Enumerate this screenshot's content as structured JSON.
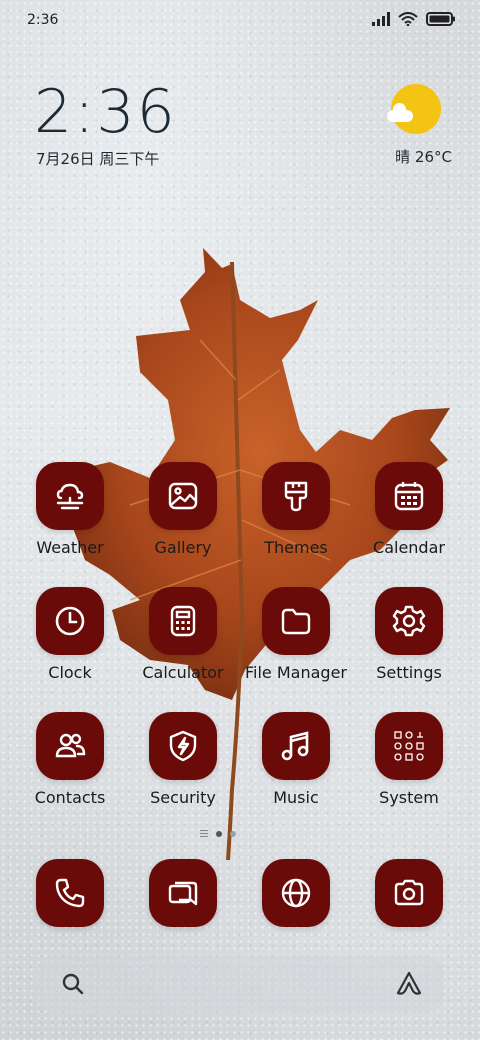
{
  "status_bar": {
    "time": "2:36"
  },
  "clock_widget": {
    "time": "2:36",
    "date": "7月26日 周三下午"
  },
  "weather_widget": {
    "condition_icon": "sun-cloud-icon",
    "text": "晴 26°C"
  },
  "apps": [
    {
      "label": "Weather",
      "icon": "weather-icon"
    },
    {
      "label": "Gallery",
      "icon": "gallery-icon"
    },
    {
      "label": "Themes",
      "icon": "themes-brush-icon"
    },
    {
      "label": "Calendar",
      "icon": "calendar-icon"
    },
    {
      "label": "Clock",
      "icon": "clock-icon"
    },
    {
      "label": "Calculator",
      "icon": "calculator-icon"
    },
    {
      "label": "File Manager",
      "icon": "folder-icon"
    },
    {
      "label": "Settings",
      "icon": "gear-icon"
    },
    {
      "label": "Contacts",
      "icon": "contacts-icon"
    },
    {
      "label": "Security",
      "icon": "shield-bolt-icon"
    },
    {
      "label": "Music",
      "icon": "music-note-icon"
    },
    {
      "label": "System",
      "icon": "folder-grid-icon"
    }
  ],
  "dock": [
    {
      "icon": "phone-icon"
    },
    {
      "icon": "messages-icon"
    },
    {
      "icon": "browser-globe-icon"
    },
    {
      "icon": "camera-icon"
    }
  ],
  "colors": {
    "icon_bg": "#6b0b09",
    "icon_fg": "#ffffff",
    "sun": "#f4c415"
  }
}
